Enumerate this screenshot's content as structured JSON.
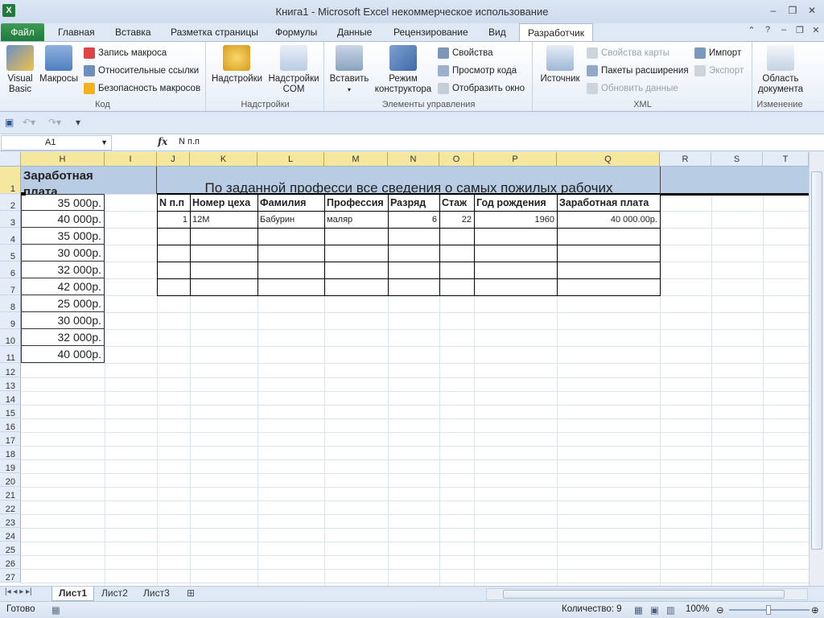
{
  "window": {
    "title": "Книга1  -  Microsoft Excel некоммерческое использование",
    "app_icon_text": "X",
    "minimize": "–",
    "restore": "❐",
    "close": "✕"
  },
  "ribbon_tabs": {
    "file": "Файл",
    "home": "Главная",
    "insert": "Вставка",
    "page_layout": "Разметка страницы",
    "formulas": "Формулы",
    "data": "Данные",
    "review": "Рецензирование",
    "view": "Вид",
    "developer": "Разработчик"
  },
  "ribbon": {
    "code": {
      "label": "Код",
      "visual_basic": "Visual\nBasic",
      "macros": "Макросы",
      "record_macro": "Запись макроса",
      "relative_refs": "Относительные ссылки",
      "macro_security": "Безопасность макросов"
    },
    "addins": {
      "label": "Надстройки",
      "addins": "Надстройки",
      "com_addins": "Надстройки\nCOM"
    },
    "controls": {
      "label": "Элементы управления",
      "insert": "Вставить",
      "design_mode": "Режим\nконструктора",
      "properties": "Свойства",
      "view_code": "Просмотр кода",
      "run_dialog": "Отобразить окно"
    },
    "xml": {
      "label": "XML",
      "source": "Источник",
      "map_properties": "Свойства карты",
      "expansion_packs": "Пакеты расширения",
      "refresh_data": "Обновить данные",
      "import": "Импорт",
      "export": "Экспорт"
    },
    "modify": {
      "label": "Изменение",
      "document_panel": "Область\nдокумента"
    }
  },
  "formula_bar": {
    "name_box": "A1",
    "fx": "fx",
    "content": "N п.п"
  },
  "columns": [
    "H",
    "I",
    "J",
    "K",
    "L",
    "M",
    "N",
    "O",
    "P",
    "Q",
    "R",
    "S",
    "T"
  ],
  "rows": [
    "1",
    "2",
    "3",
    "4",
    "5",
    "6",
    "7",
    "8",
    "9",
    "10",
    "11",
    "12",
    "13",
    "14",
    "15",
    "16",
    "17",
    "18",
    "19",
    "20",
    "21",
    "22",
    "23",
    "24",
    "25",
    "26",
    "27"
  ],
  "cells": {
    "h1": "Заработная\nплата",
    "salaries": [
      "35 000р.",
      "40 000р.",
      "35 000р.",
      "30 000р.",
      "32 000р.",
      "42 000р.",
      "25 000р.",
      "30 000р.",
      "32 000р.",
      "40 000р."
    ],
    "banner": "По заданной професси все сведения о самых пожилых рабочих",
    "table_headers": [
      "N п.п",
      "Номер цеха",
      "Фамилия",
      "Профессия",
      "Разряд",
      "Стаж",
      "Год рождения",
      "Заработная плата"
    ],
    "table_row": [
      "1",
      "12М",
      "Бабурин",
      "маляр",
      "6",
      "22",
      "1960",
      "40 000.00р."
    ]
  },
  "sheets": [
    "Лист1",
    "Лист2",
    "Лист3"
  ],
  "status": {
    "ready": "Готово",
    "count": "Количество: 9",
    "zoom": "100%"
  },
  "colors": {
    "selected_col": "#f5e79d",
    "range_fill": "#b8cce4",
    "file_tab": "#1e7a38"
  }
}
